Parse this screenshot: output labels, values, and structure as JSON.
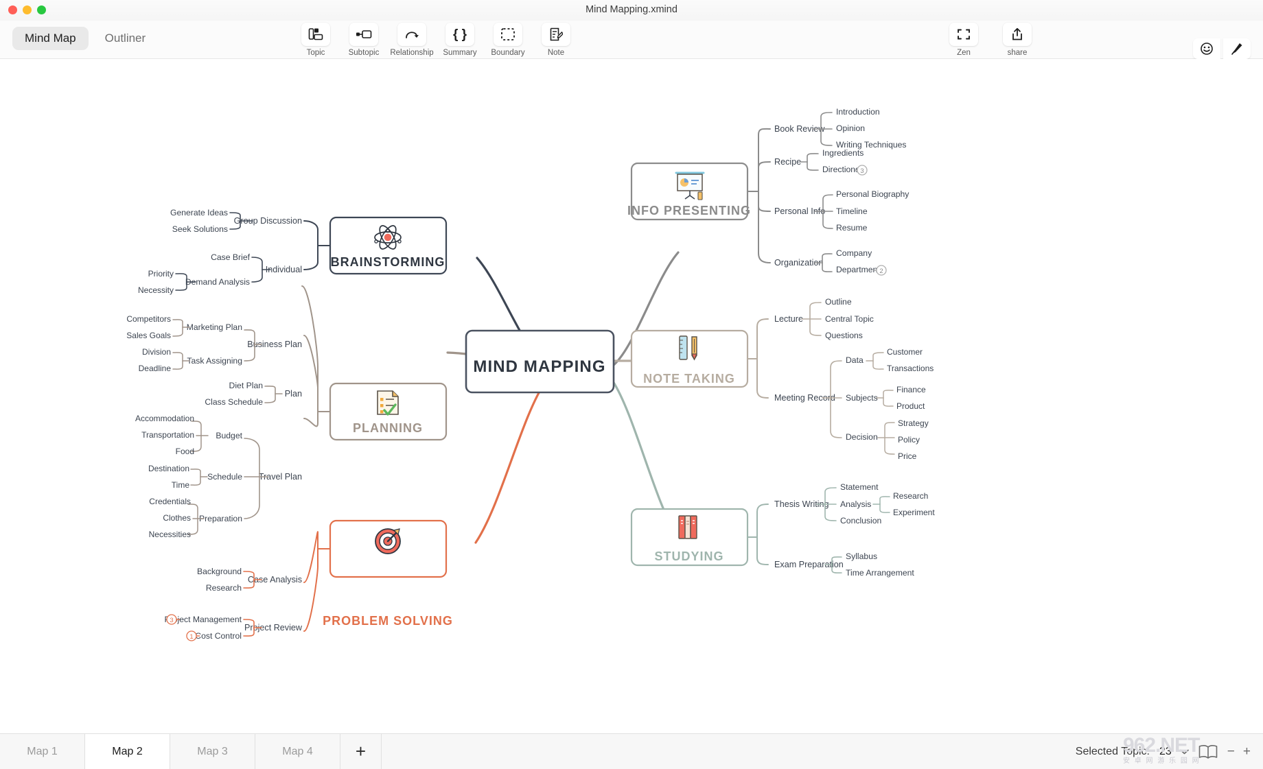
{
  "window": {
    "title": "Mind Mapping.xmind"
  },
  "modes": [
    {
      "label": "Mind Map",
      "active": true
    },
    {
      "label": "Outliner",
      "active": false
    }
  ],
  "toolbar": {
    "left_tools": [
      {
        "label": "Topic",
        "icon": "topic-icon"
      },
      {
        "label": "Subtopic",
        "icon": "subtopic-icon"
      },
      {
        "label": "Relationship",
        "icon": "relationship-icon"
      },
      {
        "label": "Summary",
        "icon": "summary-icon"
      },
      {
        "label": "Boundary",
        "icon": "boundary-icon"
      },
      {
        "label": "Note",
        "icon": "note-icon"
      }
    ],
    "right_tools": [
      {
        "label": "Zen",
        "icon": "zen-icon"
      },
      {
        "label": "share",
        "icon": "share-icon"
      }
    ],
    "panel_buttons": [
      {
        "label": "Icon",
        "icon": "smiley-icon"
      },
      {
        "label": "Format",
        "icon": "brush-icon"
      }
    ]
  },
  "statusbar": {
    "sheets": [
      {
        "label": "Map 1",
        "active": false
      },
      {
        "label": "Map 2",
        "active": true
      },
      {
        "label": "Map 3",
        "active": false
      },
      {
        "label": "Map 4",
        "active": false
      }
    ],
    "add_sheet": "+",
    "selected_topic_label": "Selected Topic:",
    "selected_topic_count": "23",
    "zoom_out": "−",
    "zoom_in": "+",
    "outline_icon": "book-icon",
    "watermark_big": "962.NET",
    "watermark_small": "安 卓 网 游 乐 园 网"
  },
  "colors": {
    "brainstorming": "#3d4654",
    "planning": "#a0948a",
    "problem_solving": "#e2704a",
    "info_presenting": "#8b8b8b",
    "note_taking": "#b6aca0",
    "studying": "#9fb5ad",
    "central": "#4a5260",
    "text": "#3c4450"
  },
  "mindmap": {
    "central": {
      "label": "MIND MAPPING"
    },
    "branches": [
      {
        "id": "brainstorming",
        "label": "BRAINSTORMING",
        "icon": "atom-icon",
        "color": "#3d4654",
        "side": "left",
        "children": [
          {
            "label": "Group Discussion",
            "children": [
              {
                "label": "Generate Ideas"
              },
              {
                "label": "Seek Solutions"
              }
            ]
          },
          {
            "label": "Individual",
            "children": [
              {
                "label": "Case Brief"
              },
              {
                "label": "Demand Analysis",
                "children": [
                  {
                    "label": "Priority"
                  },
                  {
                    "label": "Necessity"
                  }
                ]
              }
            ]
          }
        ]
      },
      {
        "id": "planning",
        "label": "PLANNING",
        "icon": "checklist-icon",
        "color": "#a0948a",
        "side": "left",
        "children": [
          {
            "label": "Business Plan",
            "children": [
              {
                "label": "Marketing Plan",
                "children": [
                  {
                    "label": "Competitors"
                  },
                  {
                    "label": "Sales Goals"
                  }
                ]
              },
              {
                "label": "Task Assigning",
                "children": [
                  {
                    "label": "Division"
                  },
                  {
                    "label": "Deadline"
                  }
                ]
              }
            ]
          },
          {
            "label": "Plan",
            "children": [
              {
                "label": "Diet Plan"
              },
              {
                "label": "Class Schedule"
              }
            ]
          },
          {
            "label": "Travel Plan",
            "children": [
              {
                "label": "Budget",
                "children": [
                  {
                    "label": "Accommodation"
                  },
                  {
                    "label": "Transportation"
                  },
                  {
                    "label": "Food"
                  }
                ]
              },
              {
                "label": "Schedule",
                "children": [
                  {
                    "label": "Destination"
                  },
                  {
                    "label": "Time"
                  }
                ]
              },
              {
                "label": "Preparation",
                "children": [
                  {
                    "label": "Credentials"
                  },
                  {
                    "label": "Clothes"
                  },
                  {
                    "label": "Necessities"
                  }
                ]
              }
            ]
          }
        ]
      },
      {
        "id": "problem-solving",
        "label": "PROBLEM SOLVING",
        "icon": "target-icon",
        "color": "#e2704a",
        "side": "left",
        "children": [
          {
            "label": "Case Analysis",
            "children": [
              {
                "label": "Background"
              },
              {
                "label": "Research"
              }
            ]
          },
          {
            "label": "Project Review",
            "children": [
              {
                "label": "Project Management",
                "marker": "3"
              },
              {
                "label": "Cost Control",
                "marker": "1"
              }
            ]
          }
        ]
      },
      {
        "id": "info-presenting",
        "label": "INFO PRESENTING",
        "icon": "presentation-icon",
        "color": "#8b8b8b",
        "side": "right",
        "children": [
          {
            "label": "Book Review",
            "children": [
              {
                "label": "Introduction"
              },
              {
                "label": "Opinion"
              },
              {
                "label": "Writing Techniques"
              }
            ]
          },
          {
            "label": "Recipe",
            "children": [
              {
                "label": "Ingredients"
              },
              {
                "label": "Directions",
                "marker": "3"
              }
            ]
          },
          {
            "label": "Personal Info",
            "children": [
              {
                "label": "Personal Biography"
              },
              {
                "label": "Timeline"
              },
              {
                "label": "Resume"
              }
            ]
          },
          {
            "label": "Organization",
            "children": [
              {
                "label": "Company"
              },
              {
                "label": "Department",
                "marker": "2"
              }
            ]
          }
        ]
      },
      {
        "id": "note-taking",
        "label": "NOTE TAKING",
        "icon": "ruler-pencil-icon",
        "color": "#b6aca0",
        "side": "right",
        "children": [
          {
            "label": "Lecture",
            "children": [
              {
                "label": "Outline"
              },
              {
                "label": "Central Topic"
              },
              {
                "label": "Questions"
              }
            ]
          },
          {
            "label": "Meeting Record",
            "children": [
              {
                "label": "Data",
                "children": [
                  {
                    "label": "Customer"
                  },
                  {
                    "label": "Transactions"
                  }
                ]
              },
              {
                "label": "Subjects",
                "children": [
                  {
                    "label": "Finance"
                  },
                  {
                    "label": "Product"
                  }
                ]
              },
              {
                "label": "Decision",
                "children": [
                  {
                    "label": "Strategy"
                  },
                  {
                    "label": "Policy"
                  },
                  {
                    "label": "Price"
                  }
                ]
              }
            ]
          }
        ]
      },
      {
        "id": "studying",
        "label": "STUDYING",
        "icon": "books-icon",
        "color": "#9fb5ad",
        "side": "right",
        "children": [
          {
            "label": "Thesis Writing",
            "children": [
              {
                "label": "Statement"
              },
              {
                "label": "Analysis",
                "children": [
                  {
                    "label": "Research"
                  },
                  {
                    "label": "Experiment"
                  }
                ]
              },
              {
                "label": "Conclusion"
              }
            ]
          },
          {
            "label": "Exam Preparation",
            "children": [
              {
                "label": "Syllabus"
              },
              {
                "label": "Time Arrangement"
              }
            ]
          }
        ]
      }
    ]
  }
}
